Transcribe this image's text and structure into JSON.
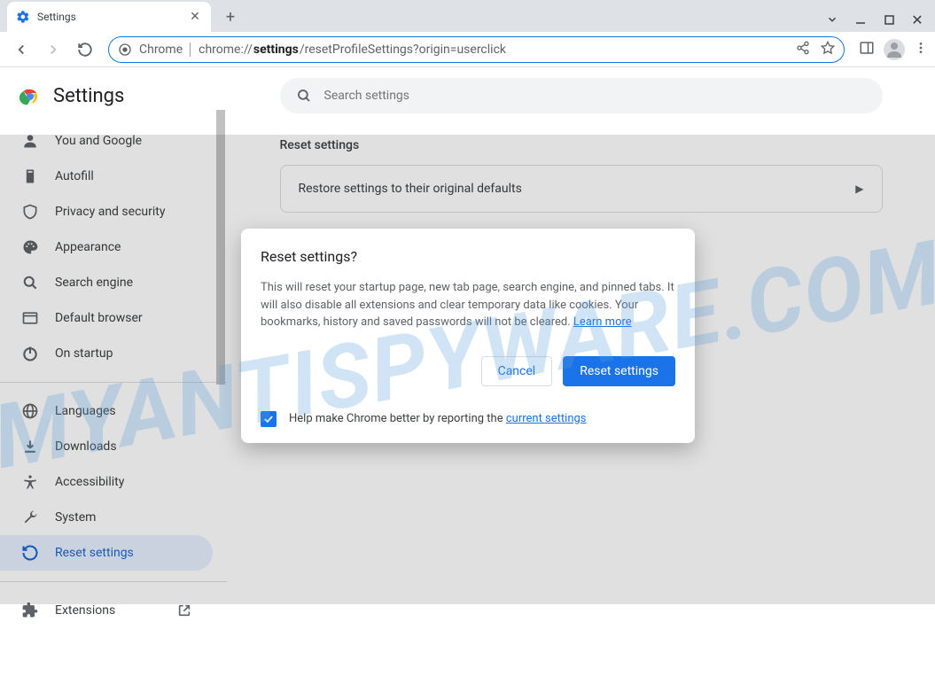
{
  "titlebar": {
    "tab_title": "Settings"
  },
  "omnibox": {
    "chip": "Chrome",
    "url_prefix": "chrome://",
    "url_bold": "settings",
    "url_rest": "/resetProfileSettings?origin=userclick"
  },
  "sidebar": {
    "title": "Settings",
    "items": [
      {
        "icon": "person",
        "label": "You and Google"
      },
      {
        "icon": "autofill",
        "label": "Autofill"
      },
      {
        "icon": "shield",
        "label": "Privacy and security"
      },
      {
        "icon": "palette",
        "label": "Appearance"
      },
      {
        "icon": "search",
        "label": "Search engine"
      },
      {
        "icon": "browser",
        "label": "Default browser"
      },
      {
        "icon": "power",
        "label": "On startup"
      }
    ],
    "items2": [
      {
        "icon": "globe",
        "label": "Languages"
      },
      {
        "icon": "download",
        "label": "Downloads"
      },
      {
        "icon": "accessibility",
        "label": "Accessibility"
      },
      {
        "icon": "wrench",
        "label": "System"
      },
      {
        "icon": "reset",
        "label": "Reset settings",
        "active": true
      }
    ],
    "items3": [
      {
        "icon": "extension",
        "label": "Extensions",
        "external": true
      }
    ]
  },
  "main": {
    "search_placeholder": "Search settings",
    "section_title": "Reset settings",
    "card_label": "Restore settings to their original defaults"
  },
  "modal": {
    "title": "Reset settings?",
    "body": "This will reset your startup page, new tab page, search engine, and pinned tabs. It will also disable all extensions and clear temporary data like cookies. Your bookmarks, history and saved passwords will not be cleared. ",
    "learn_more": "Learn more",
    "cancel": "Cancel",
    "confirm": "Reset settings",
    "footer_text": "Help make Chrome better by reporting the ",
    "footer_link": "current settings"
  },
  "watermark": "MYANTISPYWARE.COM"
}
